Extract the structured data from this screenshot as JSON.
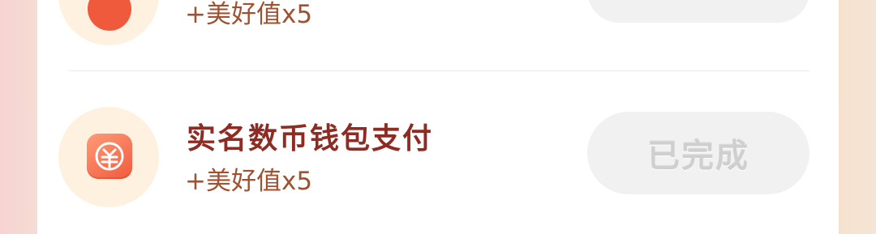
{
  "tasks": [
    {
      "reward": "+美好值x5",
      "status": ""
    },
    {
      "title": "实名数币钱包支付",
      "reward": "+美好值x5",
      "status": "已完成",
      "icon": "digital-yuan-icon"
    }
  ],
  "colors": {
    "title": "#8e2b23",
    "reward": "#a0512f",
    "icon_bg": "#fff1df",
    "icon_accent": "#f05a3c",
    "status_bg": "#f1f1f1",
    "status_text": "#cfcfcf"
  }
}
